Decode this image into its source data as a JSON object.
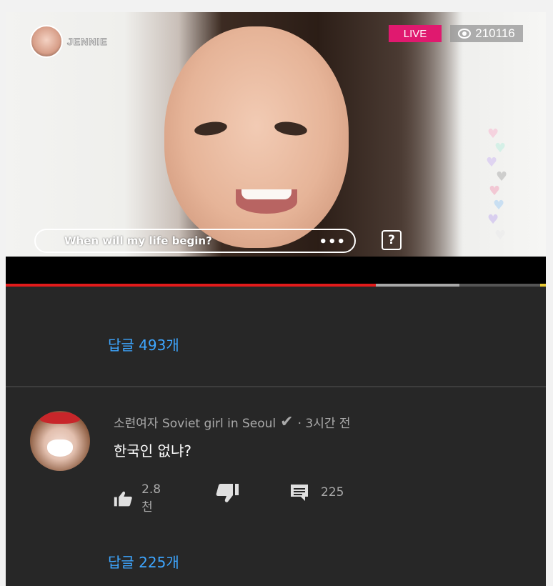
{
  "video": {
    "streamer_name": "JENNIE",
    "live_label": "LIVE",
    "viewer_count": "210116",
    "chat_message": "When will my life begin?",
    "chat_more": "•••",
    "help_icon_label": "?",
    "progress": {
      "played": 0.685,
      "buffered": 0.84
    }
  },
  "thread1": {
    "replies_label": "답글 493개"
  },
  "comment": {
    "author": "소련여자 Soviet girl in Seoul",
    "time": "· 3시간 전",
    "text": "한국인 없냐?",
    "likes": "2.8천",
    "reply_count": "225",
    "replies_label": "답글 225개"
  },
  "colors": {
    "background": "#272727",
    "link": "#3ea6ff",
    "live": "#e0196f",
    "progress": "#e21b1b"
  },
  "icons": [
    "eye-icon",
    "help-icon",
    "verified-check-icon",
    "thumbs-up-icon",
    "thumbs-down-icon",
    "comment-icon",
    "heart-icon"
  ]
}
